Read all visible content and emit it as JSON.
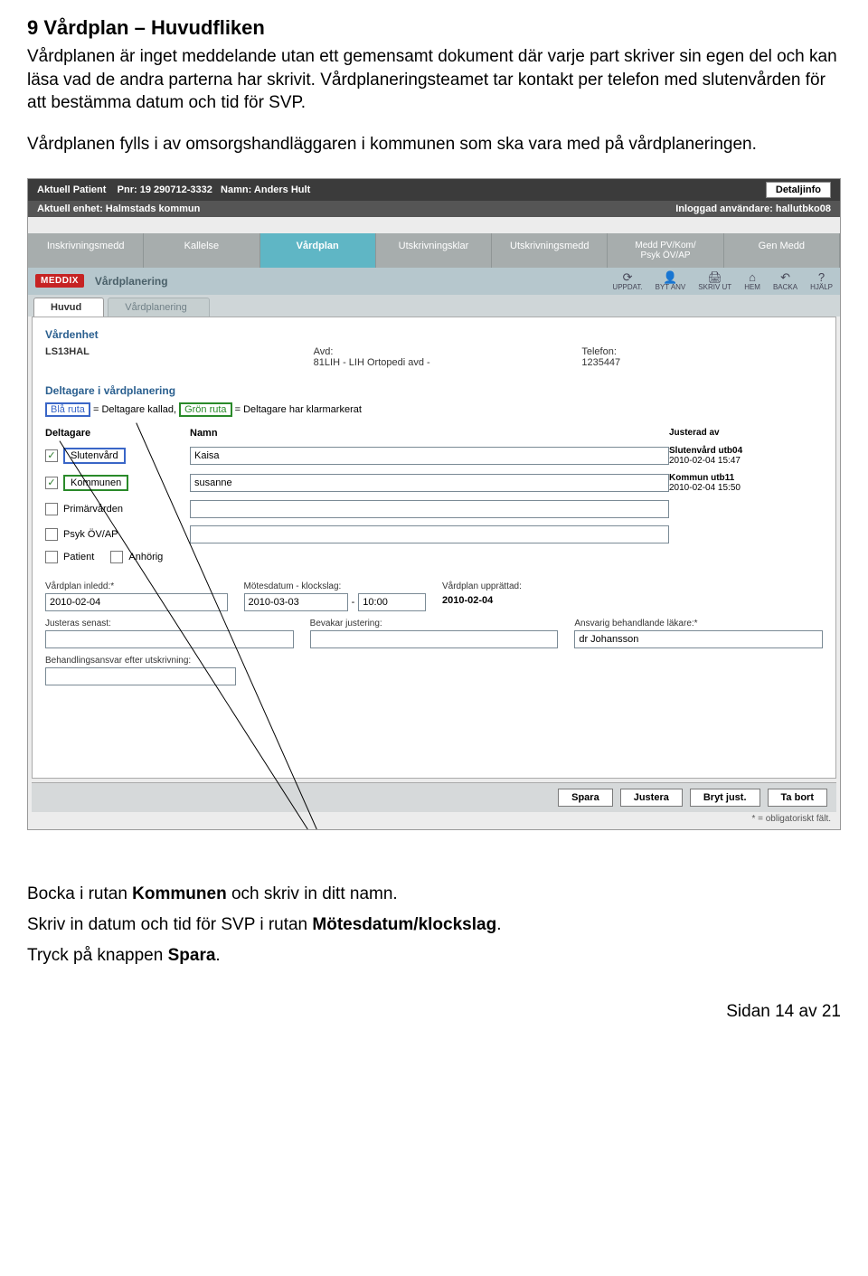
{
  "doc": {
    "heading": "9 Vårdplan – Huvudfliken",
    "p1": "Vårdplanen är inget meddelande utan ett gemensamt dokument där varje part skriver sin egen del och kan läsa vad de andra parterna har skrivit. Vårdplaneringsteamet tar kontakt per telefon med slutenvården för att bestämma datum och tid för SVP.",
    "p2": "Vårdplanen fylls i av omsorgshandläggaren i kommunen som ska vara med på vårdplaneringen.",
    "b1_a": "Bocka i rutan ",
    "b1_b": "Kommunen",
    "b1_c": " och skriv in ditt namn.",
    "b2_a": "Skriv in datum och tid för SVP i rutan ",
    "b2_b": "Mötesdatum/klockslag",
    "b2_c": ".",
    "b3_a": "Tryck på knappen ",
    "b3_b": "Spara",
    "b3_c": ".",
    "pagefoot": "Sidan 14 av 21"
  },
  "topbar": {
    "patient_label": "Aktuell Patient",
    "pnr_label": "Pnr:",
    "pnr": "19 290712-3332",
    "namn_label": "Namn:",
    "namn": "Anders Hult",
    "detaljinfo": "Detaljinfo",
    "enhet_label": "Aktuell enhet:",
    "enhet": "Halmstads kommun",
    "inloggad_label": "Inloggad användare:",
    "inloggad": "hallutbko08"
  },
  "tabs": {
    "t1": "Inskrivningsmedd",
    "t2": "Kallelse",
    "t3": "Vårdplan",
    "t4": "Utskrivningsklar",
    "t5": "Utskrivningsmedd",
    "t6a": "Medd PV/Kom/",
    "t6b": "Psyk ÖV/AP",
    "t7": "Gen Medd"
  },
  "meddix": {
    "logo": "MEDDIX",
    "title": "Vårdplanering",
    "icons": {
      "uppdat": "UPPDAT.",
      "byt": "BYT ANV",
      "skriv": "SKRIV UT",
      "hem": "HEM",
      "backa": "BACKA",
      "hjalp": "HJÄLP"
    }
  },
  "inner_tabs": {
    "huvud": "Huvud",
    "vp": "Vårdplanering"
  },
  "vardenhet": {
    "title": "Vårdenhet",
    "id": "LS13HAL",
    "avd_l": "Avd:",
    "avd": "81LIH - LIH Ortopedi avd -",
    "tel_l": "Telefon:",
    "tel": "1235447"
  },
  "legend": {
    "blue_label": "Blå ruta",
    "blue_text": " = Deltagare kallad,  ",
    "green_label": "Grön ruta",
    "green_text": " = Deltagare har klarmarkerat",
    "title": "Deltagare i vårdplanering"
  },
  "headers": {
    "deltagare": "Deltagare",
    "namn": "Namn",
    "just": "Justerad av"
  },
  "rows": {
    "slutenvard": {
      "label": "Slutenvård",
      "checked": true,
      "namn": "Kaisa",
      "just_b": "Slutenvård utb04",
      "just_t": "2010-02-04 15:47",
      "box": "blue"
    },
    "kommunen": {
      "label": "Kommunen",
      "checked": true,
      "namn": "susanne",
      "just_b": "Kommun utb11",
      "just_t": "2010-02-04 15:50",
      "box": "green"
    },
    "primar": {
      "label": "Primärvården",
      "checked": false,
      "namn": "",
      "just_b": "",
      "just_t": "",
      "box": ""
    },
    "psyk": {
      "label": "Psyk ÖV/AP",
      "checked": false,
      "namn": "",
      "just_b": "",
      "just_t": "",
      "box": ""
    },
    "patient": {
      "label": "Patient",
      "checked": false
    },
    "anhorig": {
      "label": "Anhörig",
      "checked": false
    }
  },
  "fields": {
    "inledd_l": "Vårdplan inledd:*",
    "inledd": "2010-02-04",
    "motes_l": "Mötesdatum - klockslag:",
    "motes_d": "2010-03-03",
    "motes_t": "10:00",
    "uppr_l": "Vårdplan upprättad:",
    "uppr": "2010-02-04",
    "just_l": "Justeras senast:",
    "just": "",
    "bev_l": "Bevakar justering:",
    "bev": "",
    "ansv_l": "Ansvarig behandlande läkare:*",
    "ansv": "dr Johansson",
    "beh_l": "Behandlingsansvar efter utskrivning:",
    "beh": ""
  },
  "foot": {
    "spara": "Spara",
    "justera": "Justera",
    "bryt": "Bryt just.",
    "tabort": "Ta bort"
  },
  "oblig": "* = obligatoriskt fält."
}
